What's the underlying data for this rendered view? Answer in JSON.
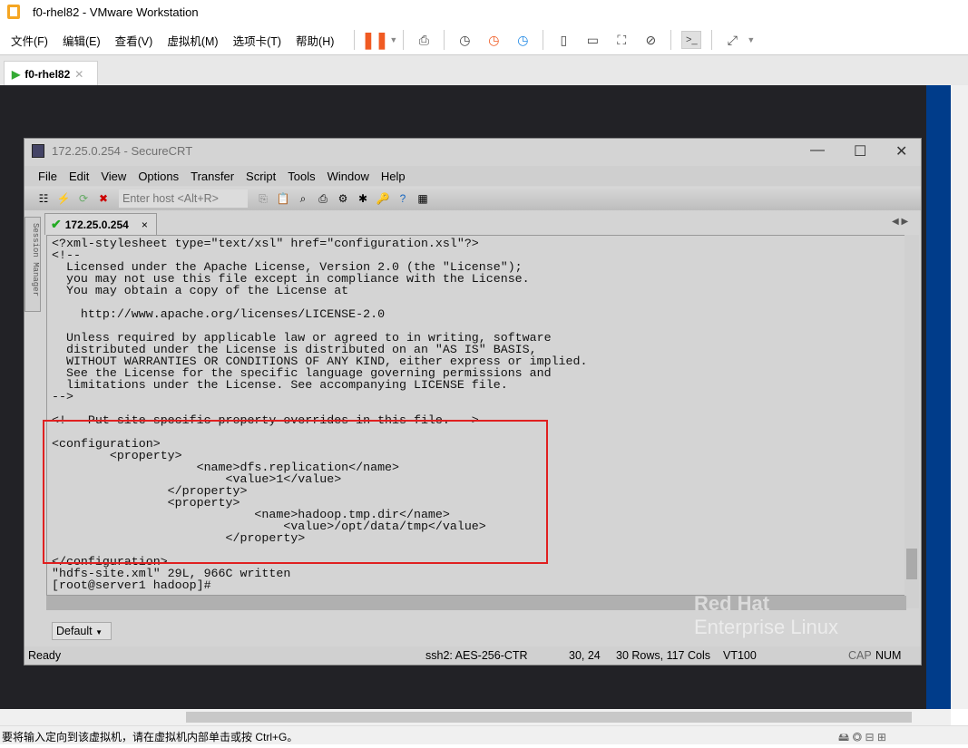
{
  "vmware": {
    "title": "f0-rhel82 - VMware Workstation",
    "menu": [
      "文件(F)",
      "编辑(E)",
      "查看(V)",
      "虚拟机(M)",
      "选项卡(T)",
      "帮助(H)"
    ],
    "tab": "f0-rhel82",
    "status": "要将输入定向到该虚拟机，请在虚拟机内部单击或按 Ctrl+G。",
    "accent": "#f05a22"
  },
  "securecrt": {
    "title": "172.25.0.254 - SecureCRT",
    "menu": [
      "File",
      "Edit",
      "View",
      "Options",
      "Transfer",
      "Script",
      "Tools",
      "Window",
      "Help"
    ],
    "host_placeholder": "Enter host <Alt+R>",
    "session_manager": "Session Manager",
    "session_tab": "172.25.0.254",
    "terminal_lines": [
      "<?xml-stylesheet type=\"text/xsl\" href=\"configuration.xsl\"?>",
      "<!--",
      "  Licensed under the Apache License, Version 2.0 (the \"License\");",
      "  you may not use this file except in compliance with the License.",
      "  You may obtain a copy of the License at",
      "",
      "    http://www.apache.org/licenses/LICENSE-2.0",
      "",
      "  Unless required by applicable law or agreed to in writing, software",
      "  distributed under the License is distributed on an \"AS IS\" BASIS,",
      "  WITHOUT WARRANTIES OR CONDITIONS OF ANY KIND, either express or implied.",
      "  See the License for the specific language governing permissions and",
      "  limitations under the License. See accompanying LICENSE file.",
      "-->",
      "",
      "<!-- Put site-specific property overrides in this file. -->",
      "",
      "<configuration>",
      "        <property>",
      "                    <name>dfs.replication</name>",
      "                        <value>1</value>",
      "                </property>",
      "                <property>",
      "                            <name>hadoop.tmp.dir</name>",
      "                                <value>/opt/data/tmp</value>",
      "                        </property>",
      "",
      "</configuration>",
      "\"hdfs-site.xml\" 29L, 966C written",
      "[root@server1 hadoop]#"
    ],
    "button_bar": "Default",
    "watermark": [
      "Red Hat",
      "Enterprise Linux"
    ],
    "status": {
      "ready": "Ready",
      "cipher": "ssh2: AES-256-CTR",
      "cursor": "30,  24",
      "size": "30 Rows, 117 Cols",
      "emulation": "VT100",
      "cap": "CAP",
      "num": "NUM"
    },
    "highlight_color": "#e02020"
  }
}
